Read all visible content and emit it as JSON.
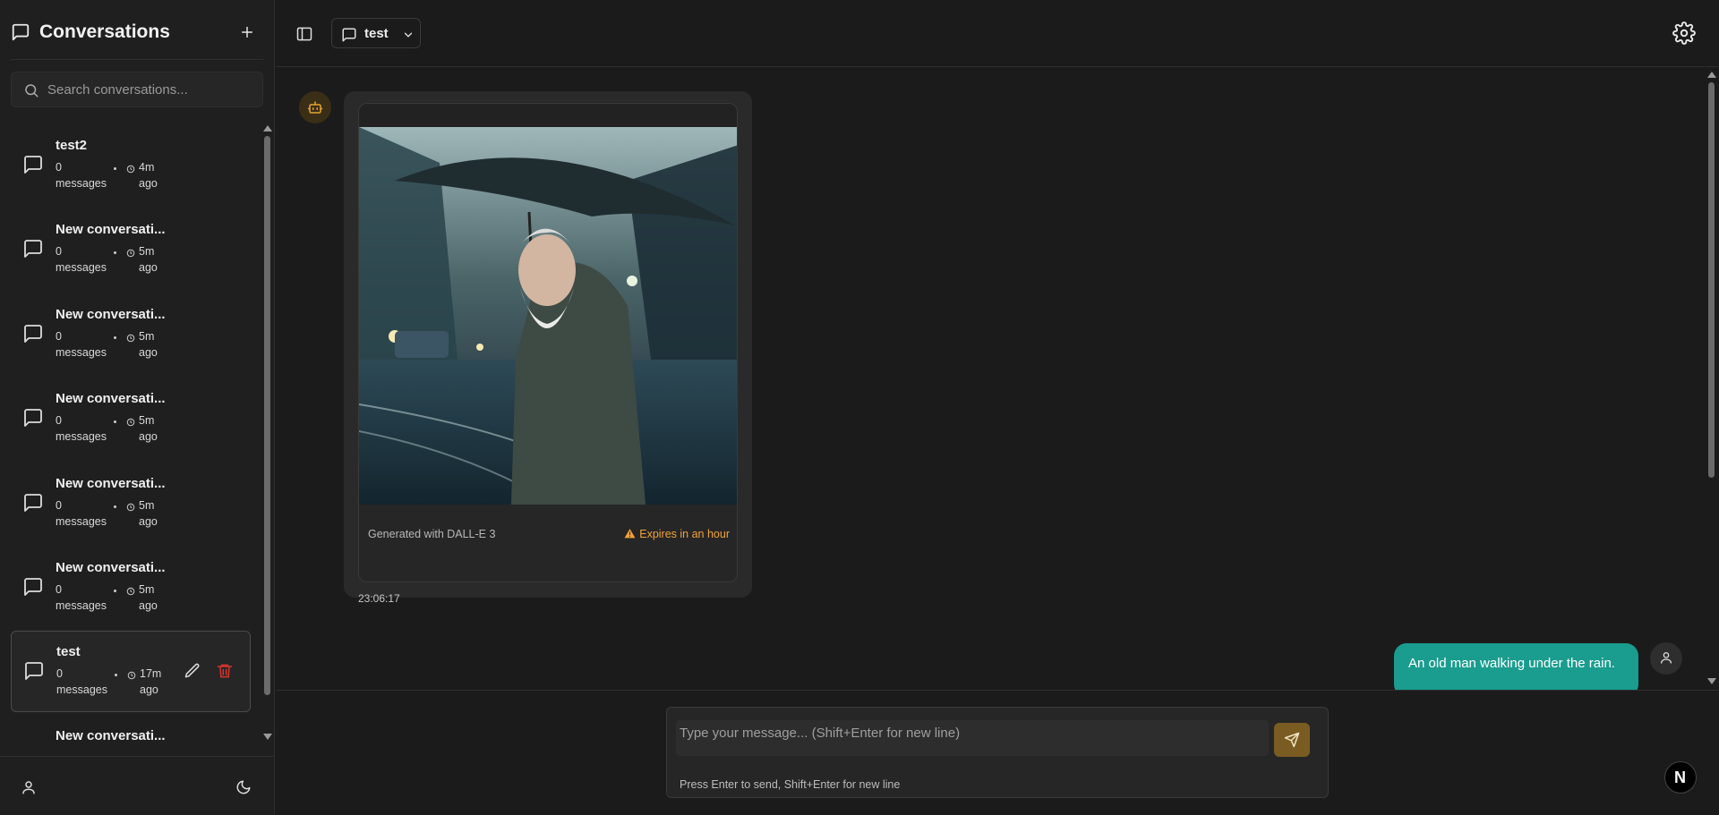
{
  "sidebar": {
    "title": "Conversations",
    "search_placeholder": "Search conversations...",
    "conversations": [
      {
        "title": "test2",
        "messages": "0 messages",
        "time": "4m ago"
      },
      {
        "title": "New conversati...",
        "messages": "0 messages",
        "time": "5m ago"
      },
      {
        "title": "New conversati...",
        "messages": "0 messages",
        "time": "5m ago"
      },
      {
        "title": "New conversati...",
        "messages": "0 messages",
        "time": "5m ago"
      },
      {
        "title": "New conversati...",
        "messages": "0 messages",
        "time": "5m ago"
      },
      {
        "title": "New conversati...",
        "messages": "0 messages",
        "time": "5m ago"
      },
      {
        "title": "test",
        "messages": "0 messages",
        "time": "17m ago",
        "active": true
      },
      {
        "title": "New conversati...",
        "messages": "",
        "time": ""
      }
    ]
  },
  "topbar": {
    "current_conversation": "test"
  },
  "chat": {
    "bot_message": {
      "image_caption": "Generated with DALL-E 3",
      "expires": "Expires in an hour",
      "time": "23:06:17"
    },
    "user_message": {
      "text": "An old man walking under the rain."
    }
  },
  "composer": {
    "placeholder": "Type your message... (Shift+Enter for new line)",
    "hint": "Press Enter to send, Shift+Enter for new line"
  },
  "badge": {
    "letter": "N"
  },
  "colors": {
    "accent_user_bubble": "#1a9c8e",
    "send_button": "#7a5c22",
    "warning": "#f2a33a",
    "delete": "#d9342b"
  }
}
